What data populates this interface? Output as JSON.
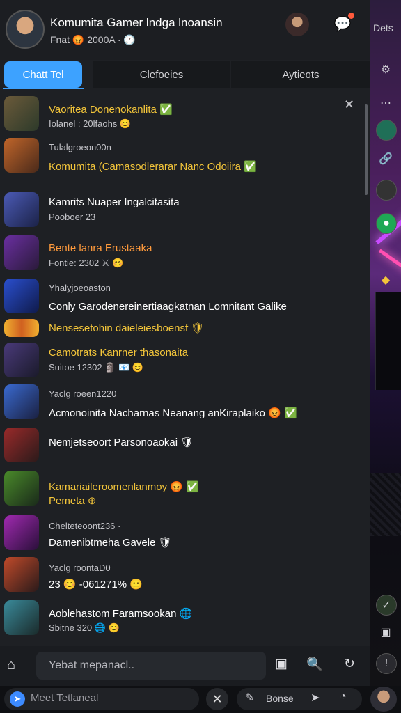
{
  "header": {
    "title": "Komumita Gamer lndga lnoansin",
    "subtitle": "Fnat 😡 2000A · 🕐"
  },
  "tabs": [
    {
      "label": "Chatt Tel"
    },
    {
      "label": "Clefoeies"
    },
    {
      "label": "Aytieots"
    }
  ],
  "chats": [
    {
      "line1": "Vaoritea Donenokanlita ✅",
      "line2": "Iolanel : 20lfaohs 😊"
    },
    {
      "line1": "Tulalgroeon00n",
      "line2": "Komumita (Camasodlerarar Nanc Odoiira ✅"
    },
    {
      "line1": "Kamrits Nuaper Ingalcitasita",
      "line2": "Pooboer 23"
    },
    {
      "line1": "Bente lanra Erustaaka",
      "line2": "Fontie: 2302 ⚔ 😊"
    },
    {
      "line1": "Yhalyjoeoaston",
      "line2": "Conly Garodenereinertiaagkatnan Lomnitant Galike"
    },
    {
      "line1": "Nensesetohin daieleiesboensf 🛡",
      "line2": ""
    },
    {
      "line1": "Camotrats Kanrner thasonaita",
      "line2": "Suitoe 12302 🗿 📧 😊"
    },
    {
      "line1": "Yaclg roeen1220",
      "line2": "Acmonoinita Nacharnas Neanang anKiraplaiko 😡 ✅"
    },
    {
      "line1": "Nemjetseoort Parsonoaokai 🛡",
      "line2": ""
    },
    {
      "line1": "Kamariaileroomenlanmoy 😡 ✅",
      "line2": "Pemeta ⊕"
    },
    {
      "line1": "Chelteteoont236 ·",
      "line2": "Damenibtmeha Gavele 🛡"
    },
    {
      "line1": "Yaclg roontaD0",
      "line2": "23 😊 -061271% 😐"
    },
    {
      "line1": "Aoblehastom Faramsookan 🌐",
      "line2": "Sbitne 320 🌐 😊"
    }
  ],
  "input": {
    "placeholder": "Yebat mepanacl.."
  },
  "taskbar": {
    "search_text": "Meet Tetlaneal",
    "pill_text": "Bonse"
  },
  "rail": {
    "label": "Dets"
  }
}
